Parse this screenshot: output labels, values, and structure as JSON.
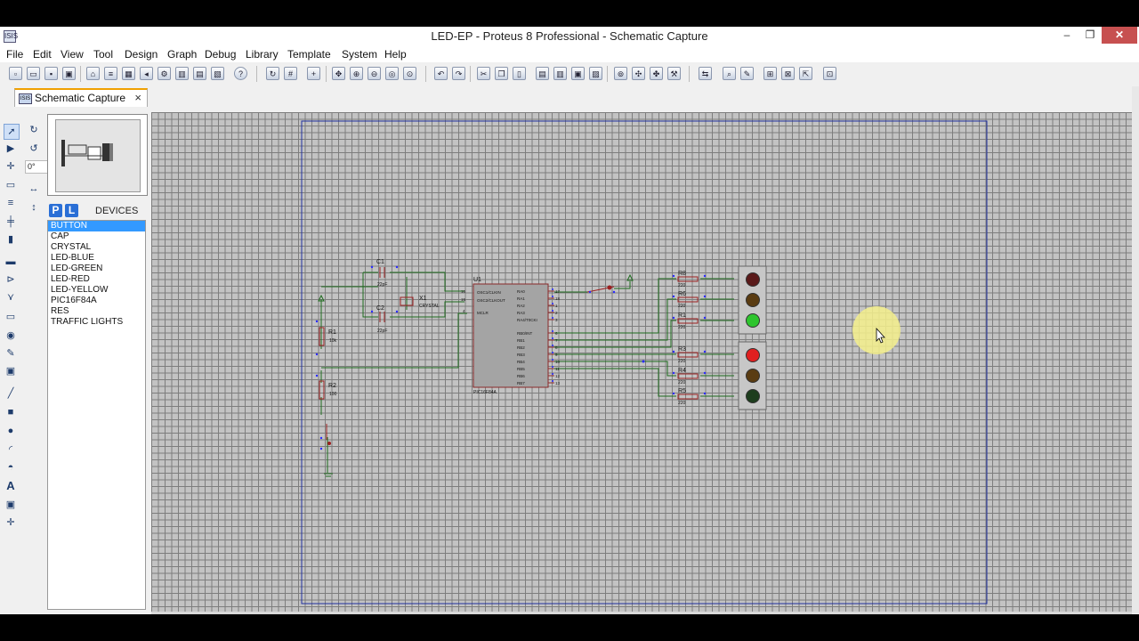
{
  "window": {
    "title": "LED-EP - Proteus 8 Professional - Schematic Capture",
    "app_icon_label": "ISIS",
    "min": "‒",
    "max": "❐",
    "close": "✕"
  },
  "menu": [
    "File",
    "Edit",
    "View",
    "Tool",
    "Design",
    "Graph",
    "Debug",
    "Library",
    "Template",
    "System",
    "Help"
  ],
  "toolbar": {
    "icons": [
      "new-icon",
      "open-icon",
      "save-icon",
      "close-project-icon",
      "home-icon",
      "schematic-icon",
      "pcb-icon",
      "3d-icon",
      "gerber-icon",
      "bom-icon",
      "source-icon",
      "vsm-icon",
      "help-icon",
      "refresh-icon",
      "grid-icon",
      "origin-icon",
      "pan-icon",
      "zoom-in-icon",
      "zoom-out-icon",
      "zoom-all-icon",
      "zoom-area-icon",
      "undo-icon",
      "redo-icon",
      "cut-icon",
      "copy-icon",
      "paste-icon",
      "block-copy-icon",
      "block-move-icon",
      "block-rotate-icon",
      "block-delete-icon",
      "pick-device-icon",
      "make-device-icon",
      "packaging-icon",
      "decompose-icon",
      "wire-autorouter-icon",
      "search-icon",
      "property-assignment-icon",
      "new-sheet-icon",
      "remove-sheet-icon",
      "exit-parent-icon",
      "erc-report-icon"
    ]
  },
  "tab": {
    "icon_label": "ISIS",
    "label": "Schematic Capture",
    "close": "×"
  },
  "tools": {
    "angle": "0°"
  },
  "devices": {
    "p_label": "P",
    "l_label": "L",
    "title": "DEVICES",
    "items": [
      "BUTTON",
      "CAP",
      "CRYSTAL",
      "LED-BLUE",
      "LED-GREEN",
      "LED-RED",
      "LED-YELLOW",
      "PIC16F84A",
      "RES",
      "TRAFFIC LIGHTS"
    ],
    "selected": "BUTTON"
  },
  "schematic": {
    "chip": {
      "ref": "U1",
      "part": "PIC16F84A",
      "left_pins": [
        "OSC1/CLKIN",
        "OSC2/CLKOUT",
        "MCLR"
      ],
      "left_pin_nums": [
        "16",
        "15",
        "4"
      ],
      "right_pins": [
        "RA0",
        "RA1",
        "RA2",
        "RA3",
        "RA4/T0CKI",
        "RB0/INT",
        "RB1",
        "RB2",
        "RB3",
        "RB4",
        "RB5",
        "RB6",
        "RB7"
      ],
      "right_pin_nums": [
        "17",
        "18",
        "1",
        "2",
        "3",
        "6",
        "7",
        "8",
        "9",
        "10",
        "11",
        "12",
        "13"
      ]
    },
    "c1": {
      "ref": "C1",
      "value": "22pF"
    },
    "c2": {
      "ref": "C2",
      "value": "22pF"
    },
    "x1": {
      "ref": "X1",
      "value": "CRYSTAL"
    },
    "r1": {
      "ref": "R1",
      "value": "10k"
    },
    "r2": {
      "ref": "R2",
      "value": "100"
    },
    "resistors_top": [
      {
        "ref": "R8",
        "value": "220"
      },
      {
        "ref": "R6",
        "value": "220"
      },
      {
        "ref": "R1",
        "value": "220"
      }
    ],
    "resistors_bottom": [
      {
        "ref": "R3",
        "value": "220"
      },
      {
        "ref": "R4",
        "value": "220"
      },
      {
        "ref": "R5",
        "value": "220"
      }
    ],
    "lights_top": [
      "#5a1a1a",
      "#5a3c12",
      "#2ec52e"
    ],
    "lights_bottom": [
      "#e02020",
      "#5a3c12",
      "#1d3d1d"
    ]
  },
  "colors": {
    "wire": "#1e6b1e",
    "part": "#9b2020",
    "chip": "#a4a4a4",
    "pin_dot": "#2a2aff",
    "cursor_highlight": "#f5f08c"
  }
}
